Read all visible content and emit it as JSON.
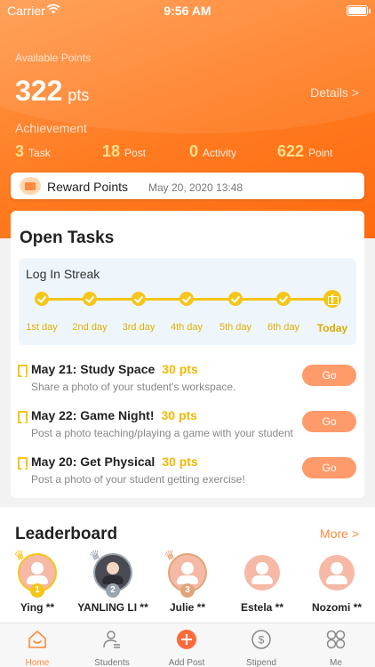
{
  "status_bar": {
    "carrier": "Carrier",
    "time": "9:56 AM"
  },
  "header": {
    "available_label": "Available Points",
    "points": "322",
    "points_unit": "pts",
    "details_link": "Details >",
    "achievement_label": "Achievement",
    "achievements": [
      {
        "value": "3",
        "label": "Task"
      },
      {
        "value": "18",
        "label": "Post"
      },
      {
        "value": "0",
        "label": "Activity"
      },
      {
        "value": "622",
        "label": "Point"
      }
    ]
  },
  "reward": {
    "title": "Reward Points",
    "date": "May 20, 2020 13:48"
  },
  "tasks": {
    "title": "Open Tasks",
    "streak": {
      "title": "Log In Streak",
      "days": [
        "1st day",
        "2nd day",
        "3rd day",
        "4th day",
        "5th day",
        "6th day",
        "Today"
      ]
    },
    "items": [
      {
        "name": "May 21: Study Space",
        "points": "30 pts",
        "description": "Share a photo of your student's workspace.",
        "action": "Go"
      },
      {
        "name": "May 22: Game Night!",
        "points": "30 pts",
        "description": "Post a photo teaching/playing a game with your student",
        "action": "Go"
      },
      {
        "name": "May 20: Get Physical",
        "points": "30 pts",
        "description": "Post a photo of your student getting exercise!",
        "action": "Go"
      }
    ]
  },
  "leaderboard": {
    "title": "Leaderboard",
    "more": "More >",
    "entries": [
      {
        "name": "Ying **",
        "rank": "1",
        "crown": "gold"
      },
      {
        "name": "YANLING LI **",
        "rank": "2",
        "crown": "silver"
      },
      {
        "name": "Julie **",
        "rank": "3",
        "crown": "bronze"
      },
      {
        "name": "Estela **"
      },
      {
        "name": "Nozomi **"
      }
    ]
  },
  "tabbar": {
    "items": [
      {
        "label": "Home",
        "icon": "home-icon"
      },
      {
        "label": "Students",
        "icon": "students-icon"
      },
      {
        "label": "Add Post",
        "icon": "add-post-icon"
      },
      {
        "label": "Stipend",
        "icon": "stipend-icon"
      },
      {
        "label": "Me",
        "icon": "me-icon"
      }
    ]
  },
  "colors": {
    "accent": "#ff7a1f",
    "gold": "#f5c518",
    "go_button": "#ff9a6a"
  }
}
